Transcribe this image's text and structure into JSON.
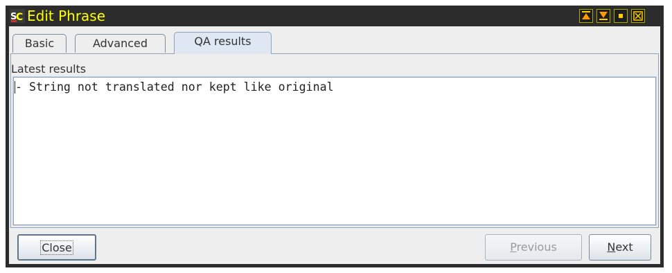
{
  "window": {
    "title": "Edit Phrase",
    "icon": "app-logo-icon",
    "controls": [
      "move-top-icon",
      "move-bottom-icon",
      "restore-icon",
      "close-icon"
    ],
    "colors": {
      "title_text": "#ffff00",
      "titlebar_bg": "#2c2c2c"
    }
  },
  "tabs": [
    {
      "label": "Basic",
      "active": false
    },
    {
      "label": "Advanced",
      "active": false
    },
    {
      "label": "QA results",
      "active": true
    }
  ],
  "qa": {
    "section_label": "Latest results",
    "results_text": "- String not translated nor kept like original"
  },
  "buttons": {
    "close": {
      "label": "Close",
      "enabled": true
    },
    "previous": {
      "mnemonic": "P",
      "rest": "revious",
      "enabled": false
    },
    "next": {
      "mnemonic": "N",
      "rest": "ext",
      "enabled": true
    }
  }
}
